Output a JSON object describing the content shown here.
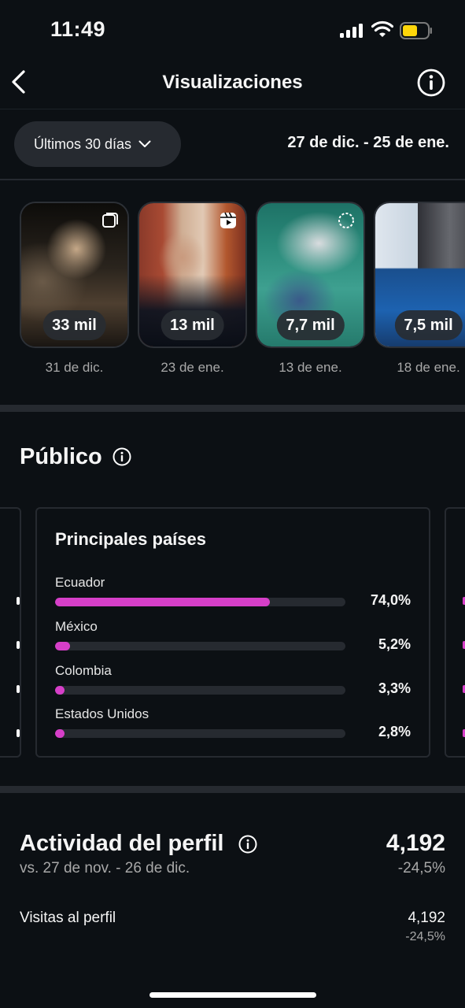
{
  "status_bar": {
    "time": "11:49"
  },
  "header": {
    "title": "Visualizaciones"
  },
  "filter": {
    "range_label": "Últimos 30 días",
    "date_range": "27 de dic. - 25 de ene."
  },
  "content": [
    {
      "views": "33 mil",
      "date": "31 de dic.",
      "type": "carousel"
    },
    {
      "views": "13 mil",
      "date": "23 de ene.",
      "type": "reel"
    },
    {
      "views": "7,7 mil",
      "date": "13 de ene.",
      "type": "story"
    },
    {
      "views": "7,5 mil",
      "date": "18 de ene.",
      "type": "post"
    }
  ],
  "audience": {
    "title": "Público",
    "card": {
      "title": "Principales países",
      "countries": [
        {
          "name": "Ecuador",
          "percent": "74,0%",
          "fraction": 0.74
        },
        {
          "name": "México",
          "percent": "5,2%",
          "fraction": 0.052
        },
        {
          "name": "Colombia",
          "percent": "3,3%",
          "fraction": 0.033
        },
        {
          "name": "Estados Unidos",
          "percent": "2,8%",
          "fraction": 0.028
        }
      ]
    }
  },
  "profile_activity": {
    "title": "Actividad del perfil",
    "comparison": "vs. 27 de nov. - 26 de dic.",
    "total": "4,192",
    "change": "-24,5%",
    "rows": [
      {
        "label": "Visitas al perfil",
        "value": "4,192",
        "change": "-24,5%"
      }
    ]
  },
  "colors": {
    "accent_bar": "#d63fc8",
    "background": "#0c1014",
    "battery": "#ffd60a"
  }
}
